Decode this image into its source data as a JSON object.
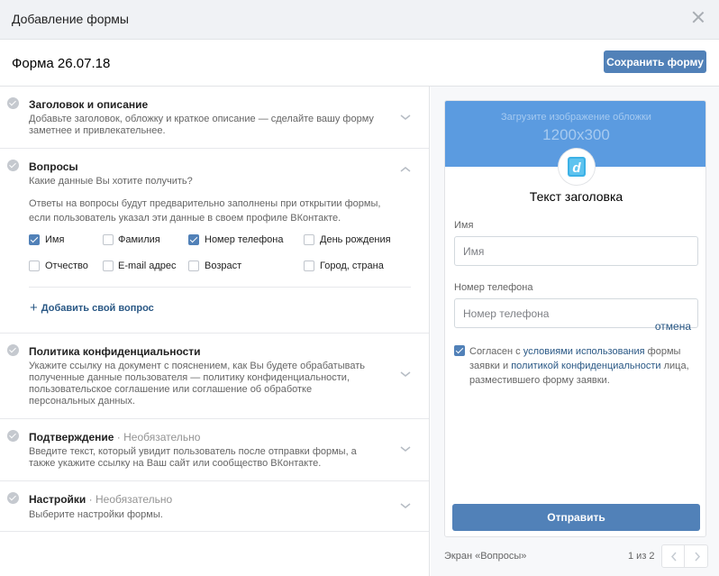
{
  "dialog": {
    "title": "Добавление формы"
  },
  "form": {
    "name": "Форма 26.07.18",
    "save_label": "Сохранить форму"
  },
  "sections": {
    "header": {
      "title": "Заголовок и описание",
      "description": "Добавьте заголовок, обложку и краткое описание — сделайте вашу форму заметнее и привлекательнее."
    },
    "questions": {
      "title": "Вопросы",
      "subtitle": "Какие данные Вы хотите получить?",
      "note": "Ответы на вопросы будут предварительно заполнены при открытии формы, если пользователь указал эти данные в своем профиле ВКонтакте.",
      "fields": [
        {
          "label": "Имя",
          "checked": true
        },
        {
          "label": "Фамилия",
          "checked": false
        },
        {
          "label": "Номер телефона",
          "checked": true
        },
        {
          "label": "День рождения",
          "checked": false
        },
        {
          "label": "Отчество",
          "checked": false
        },
        {
          "label": "E-mail адрес",
          "checked": false
        },
        {
          "label": "Возраст",
          "checked": false
        },
        {
          "label": "Город, страна",
          "checked": false
        }
      ],
      "add_label": "Добавить свой вопрос"
    },
    "privacy": {
      "title": "Политика конфиденциальности",
      "description": "Укажите ссылку на документ с пояснением, как Вы будете обрабатывать полученные данные пользователя — политику конфиденциальности, пользовательское соглашение или соглашение об обработке персональных данных."
    },
    "confirmation": {
      "title": "Подтверждение",
      "optional": "Необязательно",
      "description": "Введите текст, который увидит пользователь после отправки формы, а также укажите ссылку на Ваш сайт или сообщество ВКонтакте."
    },
    "settings": {
      "title": "Настройки",
      "optional": "Необязательно",
      "description": "Выберите настройки формы."
    }
  },
  "preview": {
    "cover_text": "Загрузите изображение обложки",
    "cover_size": "1200x300",
    "title": "Текст заголовка",
    "name_label": "Имя",
    "name_placeholder": "Имя",
    "phone_label": "Номер телефона",
    "phone_placeholder": "Номер телефона",
    "cancel_label": "отмена",
    "agree_checked": true,
    "agree_prefix": "Согласен с",
    "agree_terms_link": "условиями использования",
    "agree_middle": "формы заявки и",
    "agree_privacy_link": "политикой конфиденциальности",
    "agree_suffix": "лица, разместившего форму заявки.",
    "submit_label": "Отправить",
    "screen_label": "Экран «Вопросы»",
    "page_indicator": "1 из 2"
  },
  "colors": {
    "accent": "#5181b8",
    "link": "#2a5885",
    "cover": "#5b9be0"
  }
}
